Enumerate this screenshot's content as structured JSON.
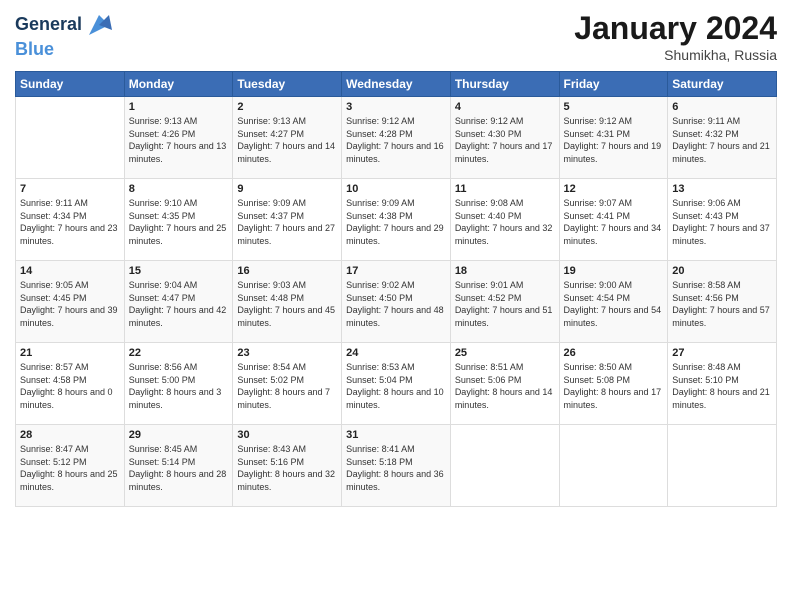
{
  "logo": {
    "line1": "General",
    "line2": "Blue"
  },
  "title": "January 2024",
  "location": "Shumikha, Russia",
  "headers": [
    "Sunday",
    "Monday",
    "Tuesday",
    "Wednesday",
    "Thursday",
    "Friday",
    "Saturday"
  ],
  "weeks": [
    [
      {
        "day": "",
        "sunrise": "",
        "sunset": "",
        "daylight": ""
      },
      {
        "day": "1",
        "sunrise": "Sunrise: 9:13 AM",
        "sunset": "Sunset: 4:26 PM",
        "daylight": "Daylight: 7 hours and 13 minutes."
      },
      {
        "day": "2",
        "sunrise": "Sunrise: 9:13 AM",
        "sunset": "Sunset: 4:27 PM",
        "daylight": "Daylight: 7 hours and 14 minutes."
      },
      {
        "day": "3",
        "sunrise": "Sunrise: 9:12 AM",
        "sunset": "Sunset: 4:28 PM",
        "daylight": "Daylight: 7 hours and 16 minutes."
      },
      {
        "day": "4",
        "sunrise": "Sunrise: 9:12 AM",
        "sunset": "Sunset: 4:30 PM",
        "daylight": "Daylight: 7 hours and 17 minutes."
      },
      {
        "day": "5",
        "sunrise": "Sunrise: 9:12 AM",
        "sunset": "Sunset: 4:31 PM",
        "daylight": "Daylight: 7 hours and 19 minutes."
      },
      {
        "day": "6",
        "sunrise": "Sunrise: 9:11 AM",
        "sunset": "Sunset: 4:32 PM",
        "daylight": "Daylight: 7 hours and 21 minutes."
      }
    ],
    [
      {
        "day": "7",
        "sunrise": "Sunrise: 9:11 AM",
        "sunset": "Sunset: 4:34 PM",
        "daylight": "Daylight: 7 hours and 23 minutes."
      },
      {
        "day": "8",
        "sunrise": "Sunrise: 9:10 AM",
        "sunset": "Sunset: 4:35 PM",
        "daylight": "Daylight: 7 hours and 25 minutes."
      },
      {
        "day": "9",
        "sunrise": "Sunrise: 9:09 AM",
        "sunset": "Sunset: 4:37 PM",
        "daylight": "Daylight: 7 hours and 27 minutes."
      },
      {
        "day": "10",
        "sunrise": "Sunrise: 9:09 AM",
        "sunset": "Sunset: 4:38 PM",
        "daylight": "Daylight: 7 hours and 29 minutes."
      },
      {
        "day": "11",
        "sunrise": "Sunrise: 9:08 AM",
        "sunset": "Sunset: 4:40 PM",
        "daylight": "Daylight: 7 hours and 32 minutes."
      },
      {
        "day": "12",
        "sunrise": "Sunrise: 9:07 AM",
        "sunset": "Sunset: 4:41 PM",
        "daylight": "Daylight: 7 hours and 34 minutes."
      },
      {
        "day": "13",
        "sunrise": "Sunrise: 9:06 AM",
        "sunset": "Sunset: 4:43 PM",
        "daylight": "Daylight: 7 hours and 37 minutes."
      }
    ],
    [
      {
        "day": "14",
        "sunrise": "Sunrise: 9:05 AM",
        "sunset": "Sunset: 4:45 PM",
        "daylight": "Daylight: 7 hours and 39 minutes."
      },
      {
        "day": "15",
        "sunrise": "Sunrise: 9:04 AM",
        "sunset": "Sunset: 4:47 PM",
        "daylight": "Daylight: 7 hours and 42 minutes."
      },
      {
        "day": "16",
        "sunrise": "Sunrise: 9:03 AM",
        "sunset": "Sunset: 4:48 PM",
        "daylight": "Daylight: 7 hours and 45 minutes."
      },
      {
        "day": "17",
        "sunrise": "Sunrise: 9:02 AM",
        "sunset": "Sunset: 4:50 PM",
        "daylight": "Daylight: 7 hours and 48 minutes."
      },
      {
        "day": "18",
        "sunrise": "Sunrise: 9:01 AM",
        "sunset": "Sunset: 4:52 PM",
        "daylight": "Daylight: 7 hours and 51 minutes."
      },
      {
        "day": "19",
        "sunrise": "Sunrise: 9:00 AM",
        "sunset": "Sunset: 4:54 PM",
        "daylight": "Daylight: 7 hours and 54 minutes."
      },
      {
        "day": "20",
        "sunrise": "Sunrise: 8:58 AM",
        "sunset": "Sunset: 4:56 PM",
        "daylight": "Daylight: 7 hours and 57 minutes."
      }
    ],
    [
      {
        "day": "21",
        "sunrise": "Sunrise: 8:57 AM",
        "sunset": "Sunset: 4:58 PM",
        "daylight": "Daylight: 8 hours and 0 minutes."
      },
      {
        "day": "22",
        "sunrise": "Sunrise: 8:56 AM",
        "sunset": "Sunset: 5:00 PM",
        "daylight": "Daylight: 8 hours and 3 minutes."
      },
      {
        "day": "23",
        "sunrise": "Sunrise: 8:54 AM",
        "sunset": "Sunset: 5:02 PM",
        "daylight": "Daylight: 8 hours and 7 minutes."
      },
      {
        "day": "24",
        "sunrise": "Sunrise: 8:53 AM",
        "sunset": "Sunset: 5:04 PM",
        "daylight": "Daylight: 8 hours and 10 minutes."
      },
      {
        "day": "25",
        "sunrise": "Sunrise: 8:51 AM",
        "sunset": "Sunset: 5:06 PM",
        "daylight": "Daylight: 8 hours and 14 minutes."
      },
      {
        "day": "26",
        "sunrise": "Sunrise: 8:50 AM",
        "sunset": "Sunset: 5:08 PM",
        "daylight": "Daylight: 8 hours and 17 minutes."
      },
      {
        "day": "27",
        "sunrise": "Sunrise: 8:48 AM",
        "sunset": "Sunset: 5:10 PM",
        "daylight": "Daylight: 8 hours and 21 minutes."
      }
    ],
    [
      {
        "day": "28",
        "sunrise": "Sunrise: 8:47 AM",
        "sunset": "Sunset: 5:12 PM",
        "daylight": "Daylight: 8 hours and 25 minutes."
      },
      {
        "day": "29",
        "sunrise": "Sunrise: 8:45 AM",
        "sunset": "Sunset: 5:14 PM",
        "daylight": "Daylight: 8 hours and 28 minutes."
      },
      {
        "day": "30",
        "sunrise": "Sunrise: 8:43 AM",
        "sunset": "Sunset: 5:16 PM",
        "daylight": "Daylight: 8 hours and 32 minutes."
      },
      {
        "day": "31",
        "sunrise": "Sunrise: 8:41 AM",
        "sunset": "Sunset: 5:18 PM",
        "daylight": "Daylight: 8 hours and 36 minutes."
      },
      {
        "day": "",
        "sunrise": "",
        "sunset": "",
        "daylight": ""
      },
      {
        "day": "",
        "sunrise": "",
        "sunset": "",
        "daylight": ""
      },
      {
        "day": "",
        "sunrise": "",
        "sunset": "",
        "daylight": ""
      }
    ]
  ]
}
